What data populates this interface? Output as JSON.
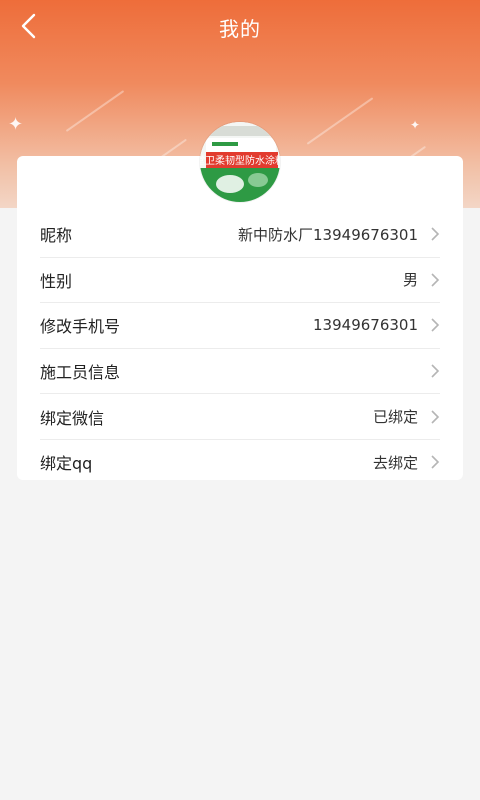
{
  "header": {
    "title": "我的",
    "accent_color": "#ee6d3a"
  },
  "profile": {
    "avatar_icon": "product-bucket-avatar",
    "avatar_text": "堂卫柔韧型防水涂料"
  },
  "rows": [
    {
      "label": "昵称",
      "value": "新中防水厂13949676301"
    },
    {
      "label": "性别",
      "value": "男"
    },
    {
      "label": "修改手机号",
      "value": "13949676301"
    },
    {
      "label": "施工员信息",
      "value": ""
    },
    {
      "label": "绑定微信",
      "value": "已绑定"
    },
    {
      "label": "绑定qq",
      "value": "去绑定"
    }
  ]
}
